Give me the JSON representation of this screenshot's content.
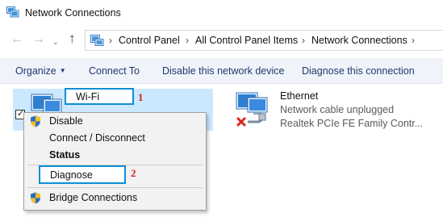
{
  "window": {
    "title": "Network Connections"
  },
  "nav": {
    "back_glyph": "←",
    "forward_glyph": "→",
    "dropdown_glyph": "⌄",
    "up_glyph": "↑"
  },
  "address": {
    "chevron": "›",
    "crumbs": [
      "Control Panel",
      "All Control Panel Items",
      "Network Connections"
    ]
  },
  "toolbar": {
    "organize": "Organize",
    "organize_arrow": "▼",
    "connect_to": "Connect To",
    "disable": "Disable this network device",
    "diagnose": "Diagnose this connection"
  },
  "wifi": {
    "name": "Wi-Fi",
    "checkmark": "✓"
  },
  "ethernet": {
    "name": "Ethernet",
    "status": "Network cable unplugged",
    "device": "Realtek PCIe FE Family Contr..."
  },
  "context_menu": {
    "disable": "Disable",
    "connect_disconnect": "Connect / Disconnect",
    "status": "Status",
    "diagnose": "Diagnose",
    "bridge": "Bridge Connections"
  },
  "annotations": {
    "step1": "1",
    "step2": "2"
  },
  "colors": {
    "highlight_border": "#0c8fd6",
    "badge_red": "#d21f1f",
    "selection_bg": "#cce8ff"
  }
}
